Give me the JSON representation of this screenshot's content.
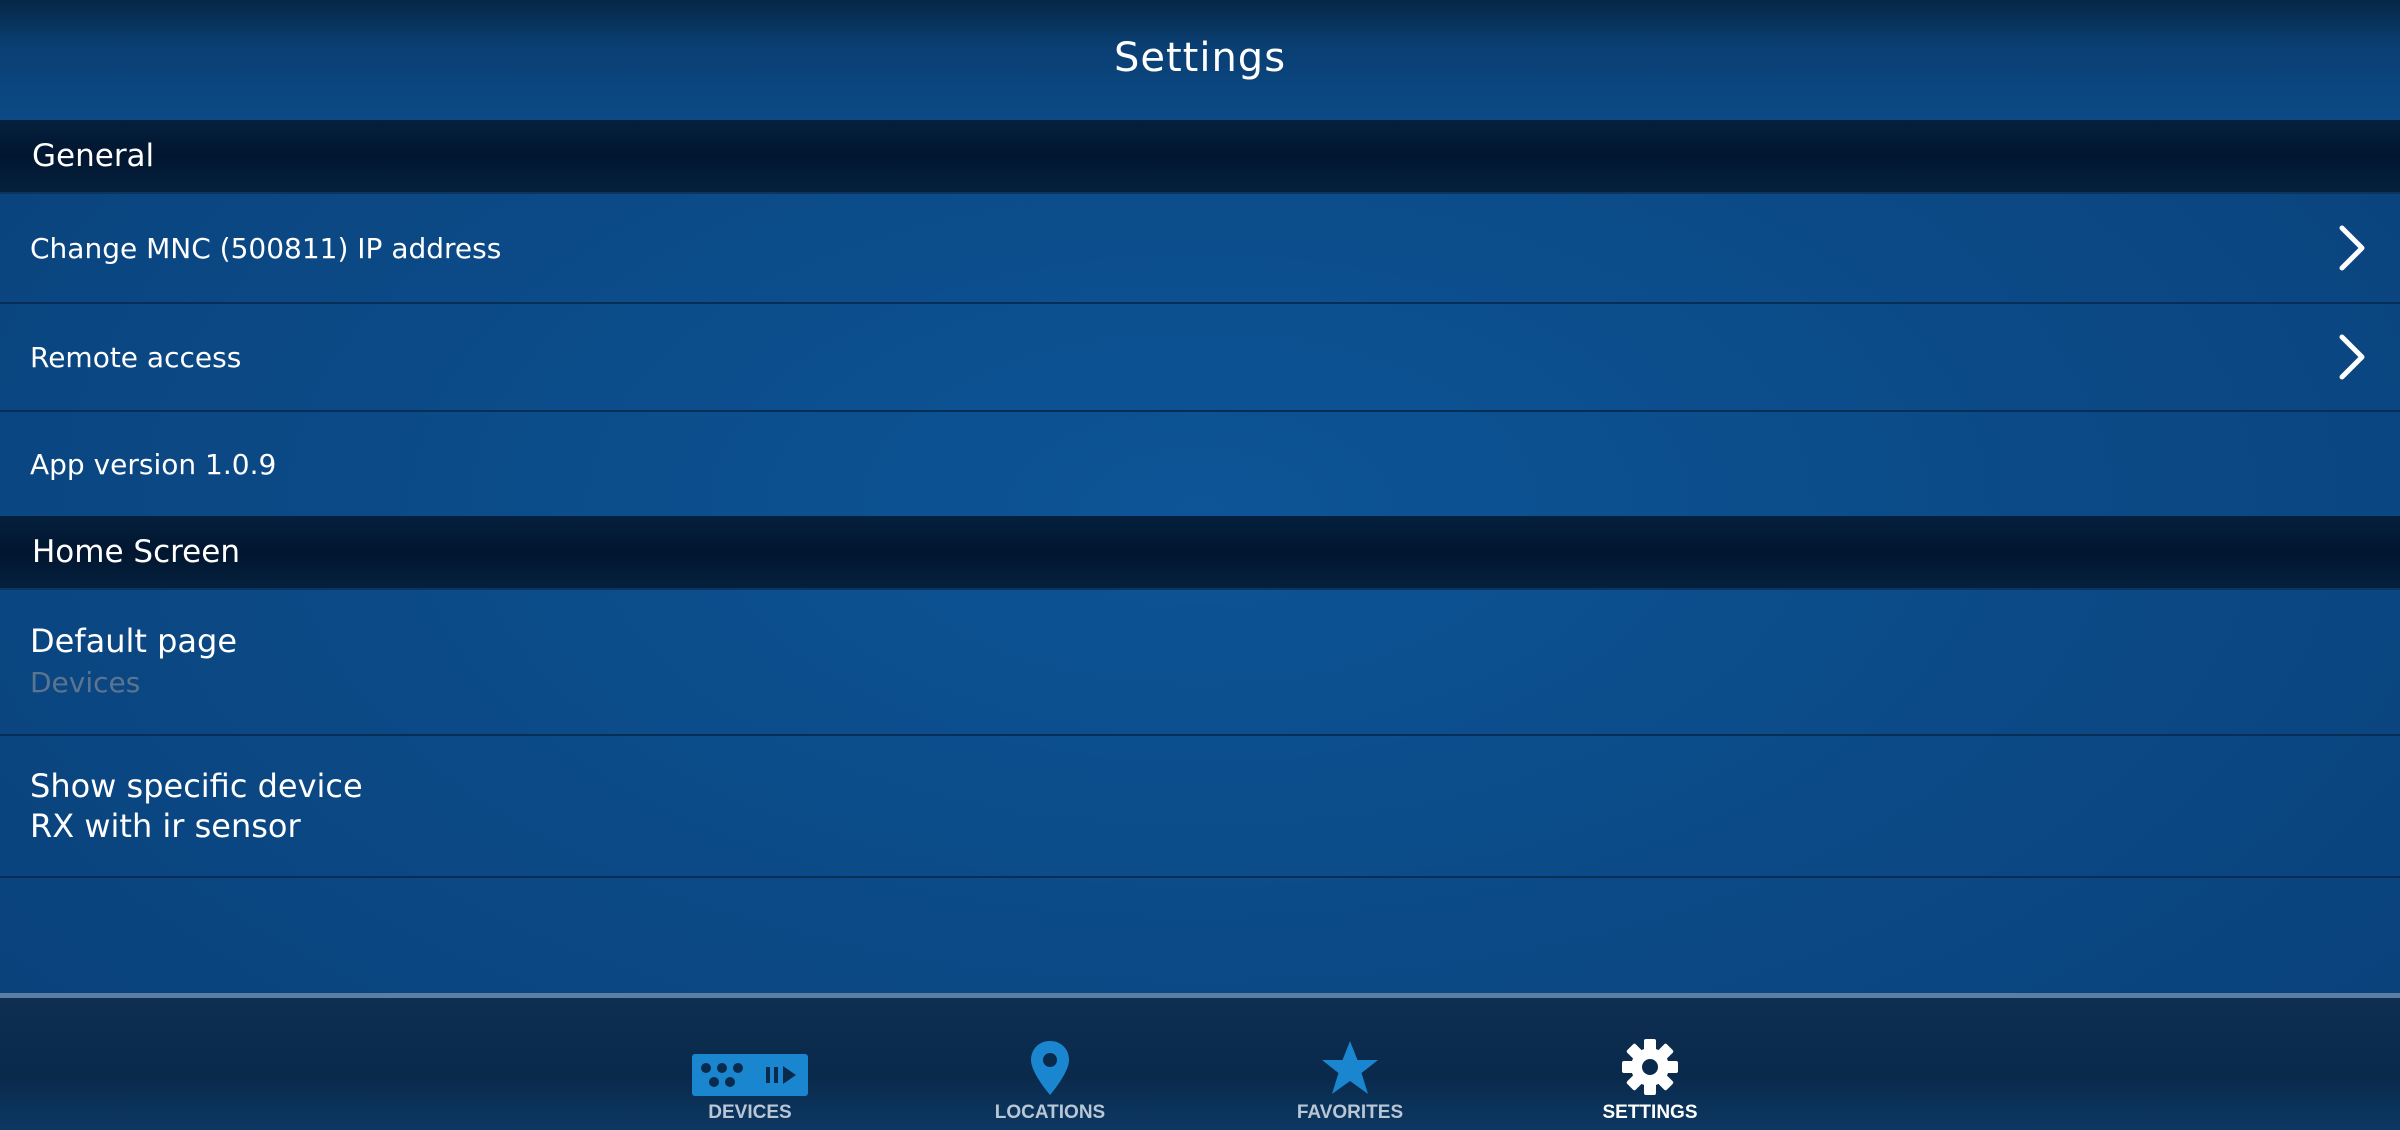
{
  "header": {
    "title": "Settings"
  },
  "sections": {
    "general": {
      "title": "General",
      "items": [
        {
          "label": "Change MNC (500811) IP address"
        },
        {
          "label": "Remote access"
        },
        {
          "label": "App version 1.0.9"
        }
      ]
    },
    "home_screen": {
      "title": "Home Screen",
      "default_page": {
        "label": "Default page",
        "value": "Devices"
      },
      "specific_device": {
        "label": "Show specific device",
        "value": "RX with ir sensor"
      }
    }
  },
  "tabs": [
    {
      "label": "DEVICES",
      "icon": "devices-icon",
      "active": false
    },
    {
      "label": "LOCATIONS",
      "icon": "location-pin-icon",
      "active": false
    },
    {
      "label": "FAVORITES",
      "icon": "star-icon",
      "active": false
    },
    {
      "label": "SETTINGS",
      "icon": "gear-icon",
      "active": true
    }
  ],
  "colors": {
    "accent_blue": "#1a86d0",
    "active_white": "#ffffff",
    "muted_value": "#5b7590"
  }
}
